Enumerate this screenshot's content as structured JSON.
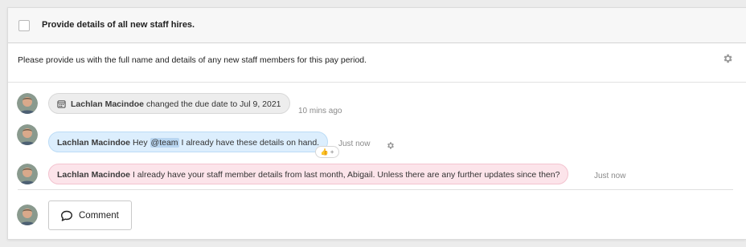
{
  "task": {
    "title": "Provide details of all new staff hires.",
    "description": "Please provide us with the full name and details of any new staff members for this pay period."
  },
  "activity": [
    {
      "type": "event",
      "author": "Lachlan Macindoe",
      "text": "changed the due date to Jul 9, 2021",
      "time": "10 mins ago"
    },
    {
      "type": "comment",
      "author": "Lachlan Macindoe",
      "text_before": "Hey ",
      "mention": "@team",
      "text_after": " I already have these details on hand.",
      "time": "Just now",
      "reaction": "👍 +"
    },
    {
      "type": "comment",
      "author": "Lachlan Macindoe",
      "text": "I already have your staff member details from last month, Abigail. Unless there are any further updates since then?",
      "time": "Just now"
    }
  ],
  "composer": {
    "button_label": "Comment"
  },
  "colors": {
    "event_bubble": "#ededed",
    "mention_bubble": "#dceefd",
    "reply_bubble": "#fce4ea"
  }
}
